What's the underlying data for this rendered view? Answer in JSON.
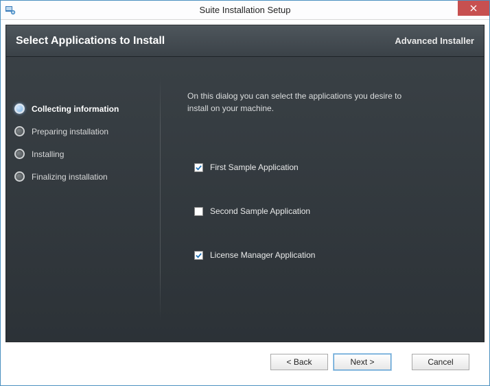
{
  "window": {
    "title": "Suite Installation Setup"
  },
  "header": {
    "page_title": "Select Applications to Install",
    "brand": "Advanced Installer"
  },
  "sidebar": {
    "steps": [
      {
        "label": "Collecting information",
        "active": true
      },
      {
        "label": "Preparing installation",
        "active": false
      },
      {
        "label": "Installing",
        "active": false
      },
      {
        "label": "Finalizing installation",
        "active": false
      }
    ]
  },
  "main": {
    "instruction": "On this dialog you can select the applications you desire to install on your machine.",
    "apps": [
      {
        "label": "First Sample Application",
        "checked": true
      },
      {
        "label": "Second Sample Application",
        "checked": false
      },
      {
        "label": "License Manager Application",
        "checked": true
      }
    ]
  },
  "footer": {
    "back": "< Back",
    "next": "Next >",
    "cancel": "Cancel"
  }
}
